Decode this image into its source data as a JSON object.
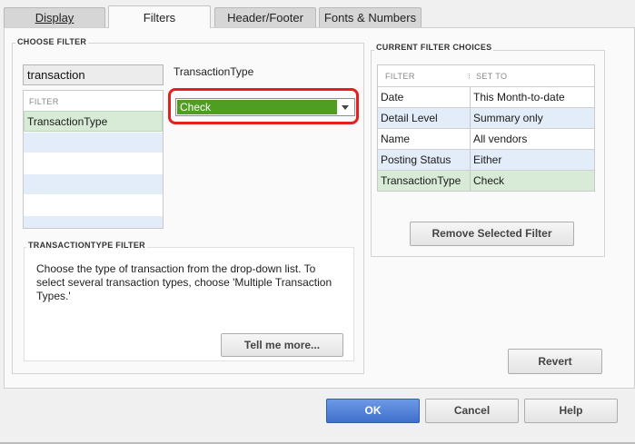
{
  "tabs": [
    {
      "label": "Display",
      "active": false
    },
    {
      "label": "Filters",
      "active": true
    },
    {
      "label": "Header/Footer",
      "active": false
    },
    {
      "label": "Fonts & Numbers",
      "active": false
    }
  ],
  "choose_filter": {
    "title": "CHOOSE FILTER",
    "search_value": "transaction",
    "list_header": "FILTER",
    "items": [
      "TransactionType"
    ],
    "selected_index": 0
  },
  "transaction_type": {
    "label": "TransactionType",
    "selected": "Check"
  },
  "filter_description": {
    "title": "TRANSACTIONTYPE FILTER",
    "text": "Choose the type of transaction from the drop-down list. To select several transaction types, choose 'Multiple Transaction Types.'",
    "tell_more": "Tell me more..."
  },
  "current_filters": {
    "title": "CURRENT FILTER CHOICES",
    "col_filter": "FILTER",
    "col_set_to": "SET TO",
    "rows": [
      {
        "filter": "Date",
        "set_to": "This Month-to-date"
      },
      {
        "filter": "Detail Level",
        "set_to": "Summary only"
      },
      {
        "filter": "Name",
        "set_to": "All vendors"
      },
      {
        "filter": "Posting Status",
        "set_to": "Either"
      },
      {
        "filter": "TransactionType",
        "set_to": "Check"
      }
    ],
    "remove_button": "Remove Selected Filter",
    "revert_button": "Revert"
  },
  "dialog_buttons": {
    "ok": "OK",
    "cancel": "Cancel",
    "help": "Help"
  },
  "colors": {
    "highlight_ring": "#e4201f",
    "selected_value_bg": "#4f9d23",
    "ok_button": "#4d7fd6"
  }
}
